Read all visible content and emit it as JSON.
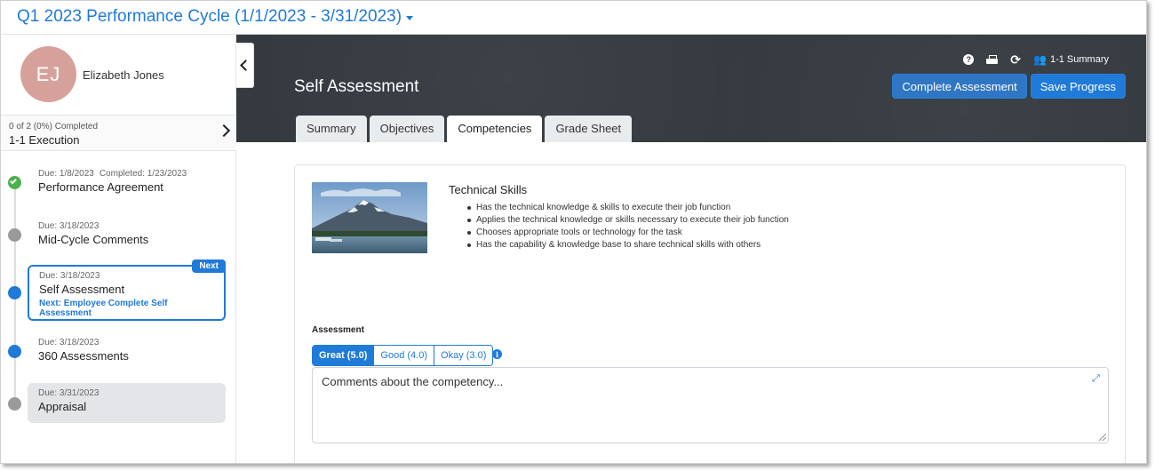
{
  "header": {
    "cycle_title": "Q1 2023 Performance Cycle (1/1/2023 - 3/31/2023)"
  },
  "profile": {
    "initials": "EJ",
    "name": "Elizabeth Jones",
    "avatar_color": "#d6a19b"
  },
  "progress": {
    "summary": "0 of 2 (0%) Completed",
    "phase": "1-1 Execution"
  },
  "timeline": {
    "items": [
      {
        "due": "Due: 1/8/2023",
        "completed": "Completed: 1/23/2023",
        "title": "Performance Agreement",
        "status": "done"
      },
      {
        "due": "Due: 3/18/2023",
        "title": "Mid-Cycle Comments",
        "status": "pending"
      },
      {
        "due": "Due: 3/18/2023",
        "title": "Self Assessment",
        "next_link": "Next: Employee Complete Self Assessment",
        "badge": "Next",
        "status": "active"
      },
      {
        "due": "Due: 3/18/2023",
        "title": "360 Assessments",
        "status": "upcoming"
      },
      {
        "due": "Due: 3/31/2023",
        "title": "Appraisal",
        "status": "pending"
      }
    ]
  },
  "page": {
    "title": "Self Assessment",
    "tools": {
      "help": "?",
      "summary_label": "1-1 Summary"
    },
    "buttons": {
      "complete": "Complete Assessment",
      "save": "Save Progress"
    },
    "tabs": [
      "Summary",
      "Objectives",
      "Competencies",
      "Grade Sheet"
    ],
    "active_tab": "Competencies"
  },
  "competency": {
    "title": "Technical Skills",
    "bullets": [
      "Has the technical knowledge & skills to execute their job function",
      "Applies the technical knowledge or skills necessary to execute their job function",
      "Chooses appropriate tools or technology for the task",
      "Has the capability & knowledge base to share technical skills with others"
    ],
    "assessment_label": "Assessment",
    "grades": [
      "Great (5.0)",
      "Good (4.0)",
      "Okay (3.0)"
    ],
    "selected_grade": "Great (5.0)",
    "comment_placeholder": "Comments about the competency..."
  },
  "colors": {
    "accent": "#1f7ad8",
    "hero_bg": "#343a40",
    "done": "#4caf50",
    "pending": "#9a9a9a"
  }
}
